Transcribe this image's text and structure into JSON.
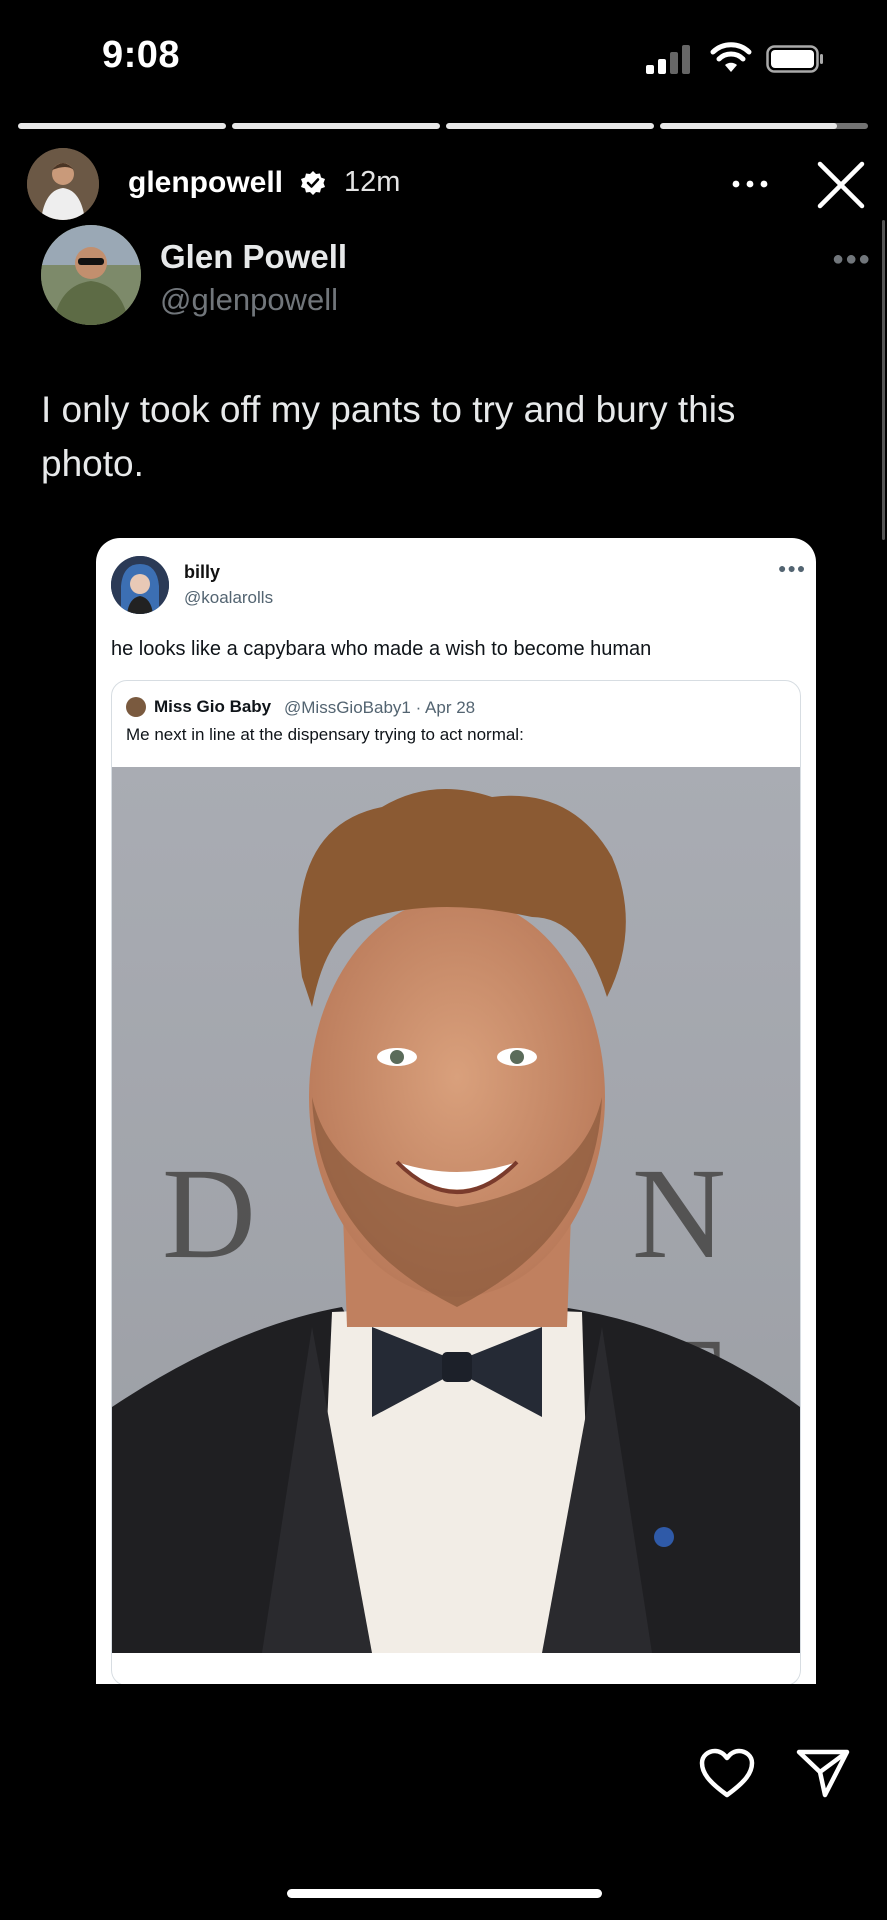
{
  "status_bar": {
    "time": "9:08"
  },
  "story": {
    "progress": [
      1,
      1,
      1,
      0.85
    ],
    "username": "glenpowell",
    "verified": true,
    "timestamp": "12m",
    "icons": {
      "more": "more-horizontal-icon",
      "close": "close-icon",
      "verified": "verified-badge-icon"
    }
  },
  "tweet": {
    "name": "Glen Powell",
    "handle": "@glenpowell",
    "text": "I only took off my pants to try and bury this photo."
  },
  "embedded_tweet": {
    "name": "billy",
    "handle": "@koalarolls",
    "text": "he looks like a capybara who made a wish to become human",
    "quote": {
      "name": "Miss Gio Baby",
      "meta": "@MissGioBaby1 · Apr 28",
      "text": "Me next in line at the dispensary trying to act normal:"
    }
  },
  "actions": {
    "like_icon": "heart-icon",
    "share_icon": "send-icon"
  },
  "colors": {
    "background": "#000000",
    "card": "#ffffff",
    "secondary_text": "#71767b"
  }
}
